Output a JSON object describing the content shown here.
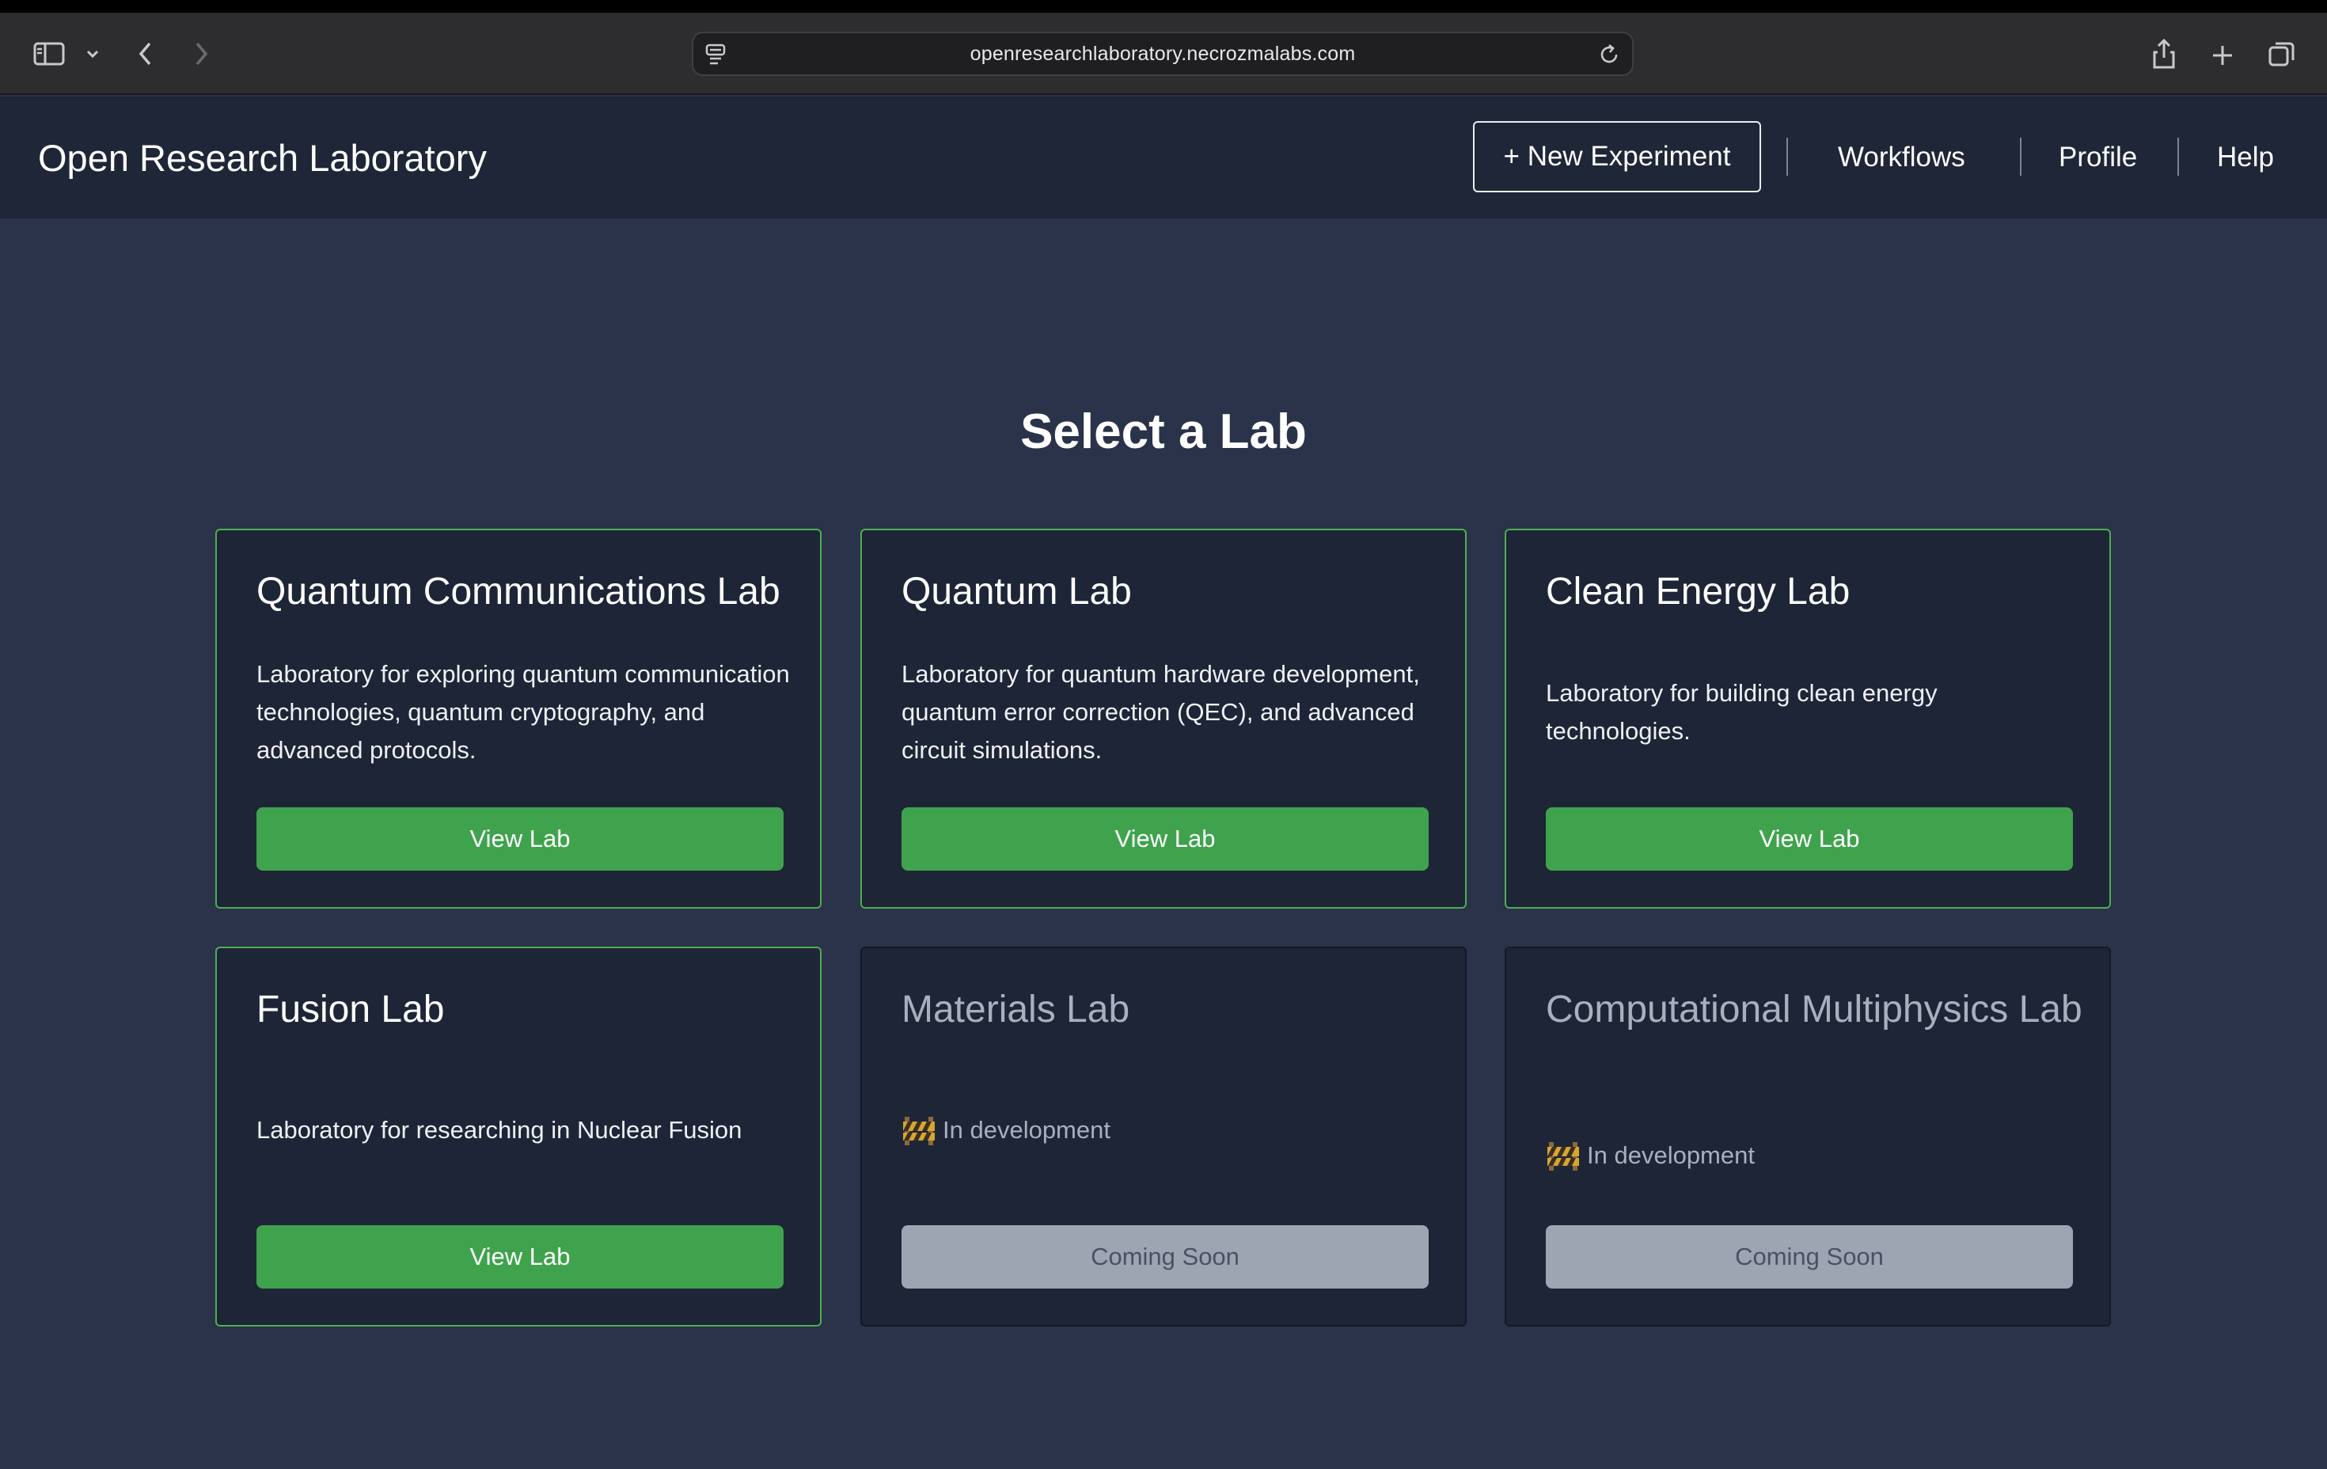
{
  "browser": {
    "url": "openresearchlaboratory.necrozmalabs.com"
  },
  "header": {
    "brand": "Open Research Laboratory",
    "new_experiment_label": "+ New Experiment",
    "nav": [
      "Workflows",
      "Profile",
      "Help"
    ]
  },
  "main": {
    "title": "Select a Lab",
    "labs": [
      {
        "title": "Quantum Communications Lab",
        "description": "Laboratory for exploring quantum communication technologies, quantum cryptography, and advanced protocols.",
        "button": "View Lab"
      },
      {
        "title": "Quantum Lab",
        "description": "Laboratory for quantum hardware development, quantum error correction (QEC), and advanced circuit simulations.",
        "button": "View Lab"
      },
      {
        "title": "Clean Energy Lab",
        "description": "Laboratory for building clean energy technologies.",
        "button": "View Lab"
      },
      {
        "title": "Fusion Lab",
        "description": "Laboratory for researching in Nuclear Fusion",
        "button": "View Lab"
      },
      {
        "title": "Materials Lab",
        "status": "In development",
        "button": "Coming Soon"
      },
      {
        "title": "Computational Multiphysics Lab",
        "status": "In development",
        "button": "Coming Soon"
      }
    ]
  },
  "colors": {
    "accent_green": "#3fa34d",
    "card_border_active": "#4caf50",
    "disabled_button": "#9ea5b2",
    "page_background": "#2a3349",
    "header_background": "#1f2637"
  },
  "icons": [
    "sidebar-icon",
    "chevron-down-icon",
    "back-icon",
    "forward-icon",
    "site-settings-icon",
    "reload-icon",
    "share-icon",
    "new-tab-icon",
    "tab-overview-icon",
    "construction-barrier-icon"
  ]
}
